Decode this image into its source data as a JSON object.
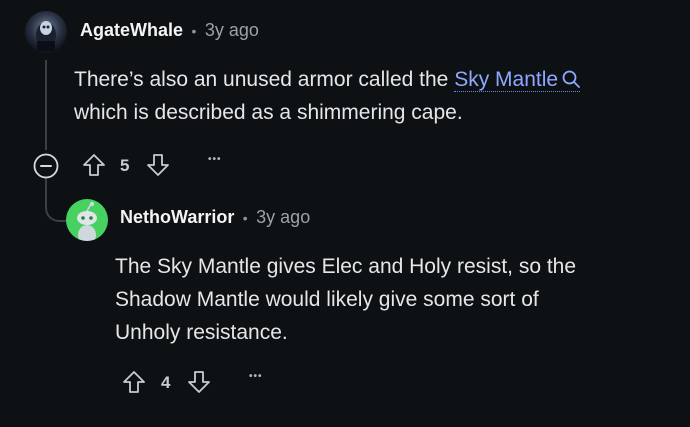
{
  "comments": [
    {
      "author": "AgateWhale",
      "separator": "•",
      "time": "3y ago",
      "text_before": "There’s also an unused armor called the",
      "link_text": "Sky Mantle",
      "text_line2": "which is described as a shimmering cape.",
      "votes": "5",
      "more": "•••"
    },
    {
      "author": "NethoWarrior",
      "separator": "•",
      "time": "3y ago",
      "lines": [
        "The Sky Mantle gives Elec and Holy resist, so the",
        "Shadow Mantle would likely give some sort of",
        "Unholy resistance."
      ],
      "votes": "4",
      "more": "•••"
    }
  ],
  "colors": {
    "background": "#0e1113",
    "link": "#8fa8ff",
    "snoo_avatar": "#46d160"
  }
}
